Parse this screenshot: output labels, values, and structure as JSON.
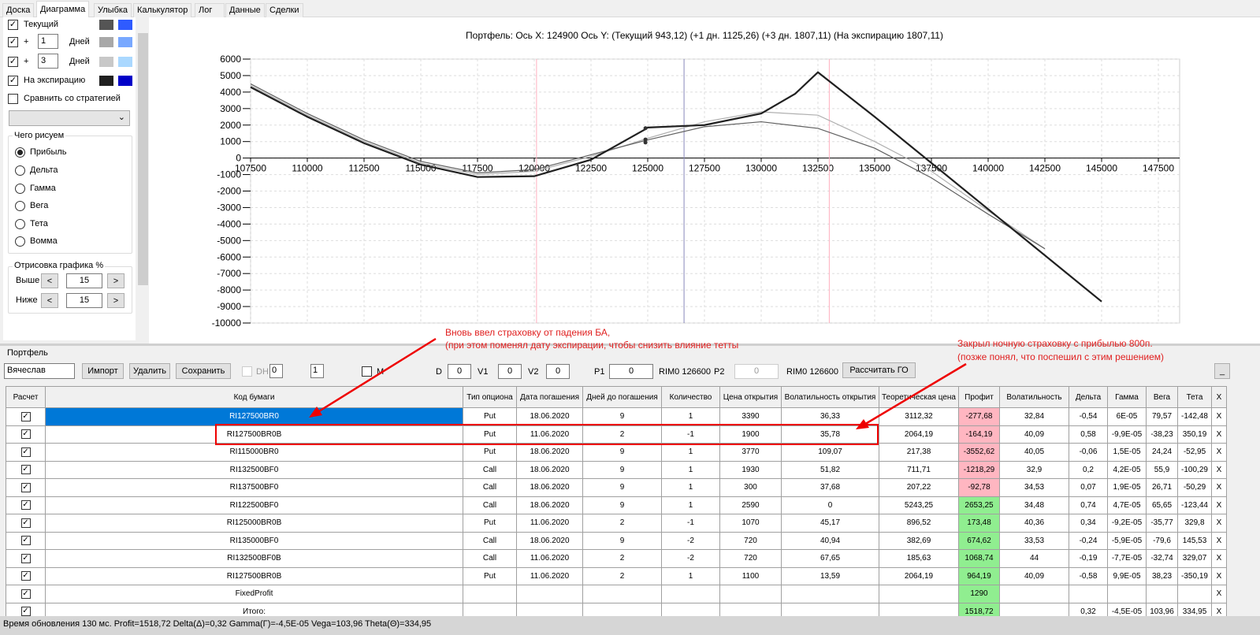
{
  "tabs": [
    "Доска",
    "Диаграмма",
    "Улыбка",
    "Калькулятор",
    "Лог",
    "Данные",
    "Сделки"
  ],
  "left": {
    "current_label": "Текущий",
    "plus": "+",
    "days_label": "Дней",
    "plus1_value": "1",
    "plus3_value": "3",
    "expiry_label": "На экспирацию",
    "compare_label": "Сравнить со стратегией",
    "colors": {
      "current": [
        "#555555",
        "#2f5bff"
      ],
      "plus1": [
        "#a8a8a8",
        "#78a8ff"
      ],
      "plus3": [
        "#c8c8c8",
        "#aad8ff"
      ],
      "expiry": [
        "#202020",
        "#0000c8"
      ]
    },
    "draw_group": "Чего рисуем",
    "radios": [
      "Прибыль",
      "Дельта",
      "Гамма",
      "Вега",
      "Тета",
      "Вомма"
    ],
    "range_group": "Отрисовка графика %",
    "above_label": "Выше",
    "below_label": "Ниже",
    "above_value": "15",
    "below_value": "15",
    "dec": "<",
    "inc": ">"
  },
  "chart_data": {
    "type": "line",
    "title": "Портфель: Ось X:  124900 Ось Y:  (Текущий 943,12)  (+1 дн. 1125,26)  (+3 дн. 1807,11)  (На экспирацию 1807,11)",
    "xlim": [
      107500,
      147500
    ],
    "ylim": [
      -10000,
      6000
    ],
    "xticks": [
      "107500",
      "110000",
      "112500",
      "115000",
      "117500",
      "120000",
      "122500",
      "125000",
      "127500",
      "130000",
      "132500",
      "135000",
      "137500",
      "140000",
      "142500",
      "145000",
      "147500"
    ],
    "yticks": [
      "6000",
      "5000",
      "4000",
      "3000",
      "2000",
      "1000",
      "0",
      "-1000",
      "-2000",
      "-3000",
      "-4000",
      "-5000",
      "-6000",
      "-7000",
      "-8000",
      "-9000",
      "-10000"
    ],
    "vlines": [
      {
        "x": 126600,
        "color": "#8888bb"
      },
      {
        "x": 120100,
        "color": "#ffb0c0"
      },
      {
        "x": 133000,
        "color": "#ffb0c0"
      }
    ],
    "series": [
      {
        "name": "На экспирацию",
        "color": "#202020",
        "width": 2.2,
        "x": [
          107500,
          110000,
          112500,
          115000,
          117500,
          120000,
          122500,
          124900,
          125000,
          127500,
          130000,
          131500,
          132500,
          135000,
          137500,
          140000,
          142500,
          145000
        ],
        "y": [
          4300,
          2500,
          900,
          -400,
          -1150,
          -1100,
          -100,
          1750,
          1850,
          2000,
          2700,
          3900,
          5200,
          2500,
          -300,
          -3100,
          -5900,
          -8700
        ]
      },
      {
        "name": "Текущий",
        "color": "#606060",
        "width": 1.2,
        "x": [
          107500,
          110000,
          112500,
          115000,
          117500,
          120000,
          122500,
          125000,
          127500,
          130000,
          132500,
          135000,
          137500,
          140000,
          142500
        ],
        "y": [
          4500,
          2700,
          1100,
          -200,
          -900,
          -700,
          200,
          1100,
          1900,
          2200,
          1800,
          600,
          -1200,
          -3400,
          -5500
        ]
      },
      {
        "name": "+1 дн.",
        "color": "#b0b0b0",
        "width": 1.2,
        "x": [
          107500,
          110000,
          112500,
          115000,
          117500,
          120000,
          122500,
          125000,
          127500,
          130000,
          132500,
          135000,
          137500,
          140000,
          142500
        ],
        "y": [
          4400,
          2600,
          1000,
          -300,
          -1000,
          -800,
          100,
          1200,
          2200,
          2800,
          2600,
          1000,
          -800,
          -3200,
          -5500
        ]
      }
    ],
    "points": [
      {
        "x": 124900,
        "y": 1807
      },
      {
        "x": 124900,
        "y": 1125
      },
      {
        "x": 124900,
        "y": 943
      }
    ]
  },
  "portfolio": {
    "group": "Портфель",
    "account": "Вячеслав",
    "import": "Импорт",
    "delete": "Удалить",
    "save": "Сохранить",
    "dh": "DH",
    "spin1": "0",
    "spin2": "1",
    "m": "M",
    "d_label": "D",
    "d": "0",
    "v1_label": "V1",
    "v1": "0",
    "v2_label": "V2",
    "v2": "0",
    "p1_label": "P1",
    "p1": "0",
    "rim1": "RIM0 126600",
    "p2_label": "P2",
    "p2": "0",
    "rim2": "RIM0 126600",
    "calc": "Рассчитать ГО",
    "min": "_"
  },
  "table": {
    "headers": [
      "Расчет",
      "Код бумаги",
      "Тип опциона",
      "Дата погашения",
      "Дней до погашения",
      "Количество",
      "Цена открытия",
      "Волатильность открытия",
      "Теоретическая цена",
      "Профит",
      "Волатильность",
      "Дельта",
      "Гамма",
      "Вега",
      "Тета",
      "X"
    ],
    "rows": [
      [
        "RI127500BR0",
        "Put",
        "18.06.2020",
        "9",
        "1",
        "3390",
        "36,33",
        "3112,32",
        "-277,68",
        "32,84",
        "-0,54",
        "6E-05",
        "79,57",
        "-142,48",
        "X"
      ],
      [
        "RI127500BR0B",
        "Put",
        "11.06.2020",
        "2",
        "-1",
        "1900",
        "35,78",
        "2064,19",
        "-164,19",
        "40,09",
        "0,58",
        "-9,9E-05",
        "-38,23",
        "350,19",
        "X"
      ],
      [
        "RI115000BR0",
        "Put",
        "18.06.2020",
        "9",
        "1",
        "3770",
        "109,07",
        "217,38",
        "-3552,62",
        "40,05",
        "-0,06",
        "1,5E-05",
        "24,24",
        "-52,95",
        "X"
      ],
      [
        "RI132500BF0",
        "Call",
        "18.06.2020",
        "9",
        "1",
        "1930",
        "51,82",
        "711,71",
        "-1218,29",
        "32,9",
        "0,2",
        "4,2E-05",
        "55,9",
        "-100,29",
        "X"
      ],
      [
        "RI137500BF0",
        "Call",
        "18.06.2020",
        "9",
        "1",
        "300",
        "37,68",
        "207,22",
        "-92,78",
        "34,53",
        "0,07",
        "1,9E-05",
        "26,71",
        "-50,29",
        "X"
      ],
      [
        "RI122500BF0",
        "Call",
        "18.06.2020",
        "9",
        "1",
        "2590",
        "0",
        "5243,25",
        "2653,25",
        "34,48",
        "0,74",
        "4,7E-05",
        "65,65",
        "-123,44",
        "X"
      ],
      [
        "RI125000BR0B",
        "Put",
        "11.06.2020",
        "2",
        "-1",
        "1070",
        "45,17",
        "896,52",
        "173,48",
        "40,36",
        "0,34",
        "-9,2E-05",
        "-35,77",
        "329,8",
        "X"
      ],
      [
        "RI135000BF0",
        "Call",
        "18.06.2020",
        "9",
        "-2",
        "720",
        "40,94",
        "382,69",
        "674,62",
        "33,53",
        "-0,24",
        "-5,9E-05",
        "-79,6",
        "145,53",
        "X"
      ],
      [
        "RI132500BF0B",
        "Call",
        "11.06.2020",
        "2",
        "-2",
        "720",
        "67,65",
        "185,63",
        "1068,74",
        "44",
        "-0,19",
        "-7,7E-05",
        "-32,74",
        "329,07",
        "X"
      ],
      [
        "RI127500BR0B",
        "Put",
        "11.06.2020",
        "2",
        "1",
        "1100",
        "13,59",
        "2064,19",
        "964,19",
        "40,09",
        "-0,58",
        "9,9E-05",
        "38,23",
        "-350,19",
        "X"
      ],
      [
        "FixedProfit",
        "",
        "",
        "",
        "",
        "",
        "",
        "",
        "1290",
        "",
        "",
        "",
        "",
        "",
        "X"
      ],
      [
        "Итого:",
        "",
        "",
        "",
        "",
        "",
        "",
        "",
        "1518,72",
        "",
        "0,32",
        "-4,5E-05",
        "103,96",
        "334,95",
        "X"
      ]
    ]
  },
  "annotations": {
    "left1": "Вновь ввел страховку от падения БА,",
    "left2": "(при этом поменял дату экспирации, чтобы снизить влияние тетты",
    "right1": "Закрыл ночную страховку с прибылью 800п.",
    "right2": "(позже понял, что поспешил с этим решением)"
  },
  "status": "Время обновления 130 мс. Profit=1518,72 Delta(Δ)=0,32 Gamma(Γ)=-4,5E-05 Vega=103,96 Theta(Θ)=334,95"
}
